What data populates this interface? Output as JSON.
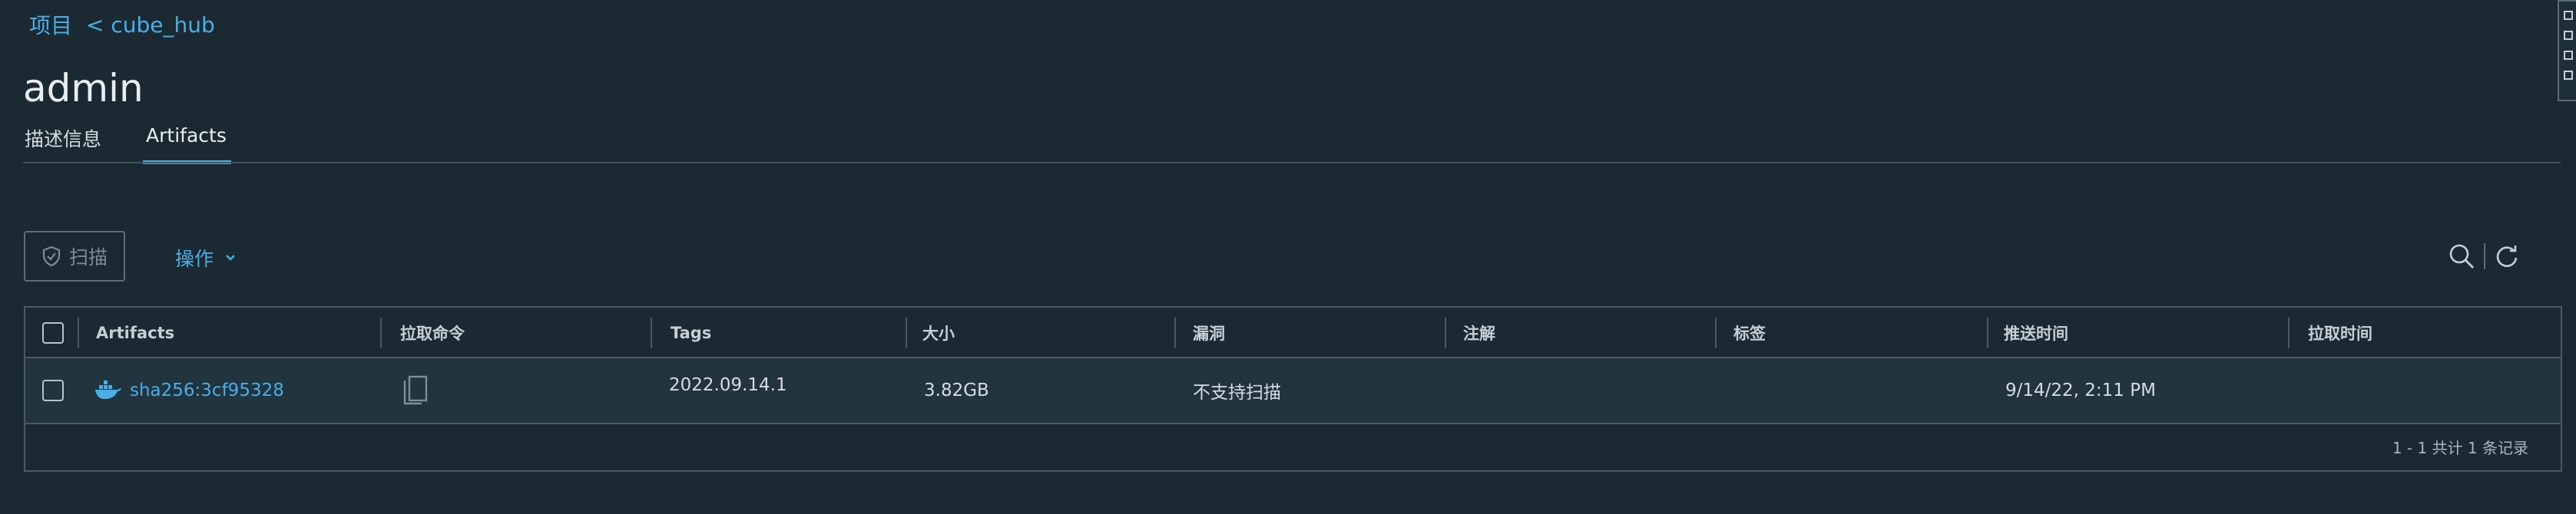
{
  "breadcrumb": {
    "root": "项目",
    "sep": "<",
    "project": "cube_hub"
  },
  "page": {
    "title": "admin"
  },
  "tabs": [
    {
      "label": "描述信息",
      "active": false
    },
    {
      "label": "Artifacts",
      "active": true
    }
  ],
  "toolbar": {
    "scan_label": "扫描",
    "actions_label": "操作",
    "icons": [
      "search-icon",
      "refresh-icon"
    ]
  },
  "table": {
    "columns": [
      "Artifacts",
      "拉取命令",
      "Tags",
      "大小",
      "漏洞",
      "注解",
      "标签",
      "推送时间",
      "拉取时间"
    ],
    "rows": [
      {
        "artifact": "sha256:3cf95328",
        "tags": "2022.09.14.1",
        "size": "3.82GB",
        "vulnerabilities": "不支持扫描",
        "annotations": "",
        "labels": "",
        "push_time": "9/14/22, 2:11 PM",
        "pull_time": ""
      }
    ],
    "footer": "1 - 1 共计 1 条记录"
  },
  "colors": {
    "background": "#1b2a32",
    "accent": "#49aee8",
    "border": "#4a5962",
    "row_bg": "#22343d"
  }
}
